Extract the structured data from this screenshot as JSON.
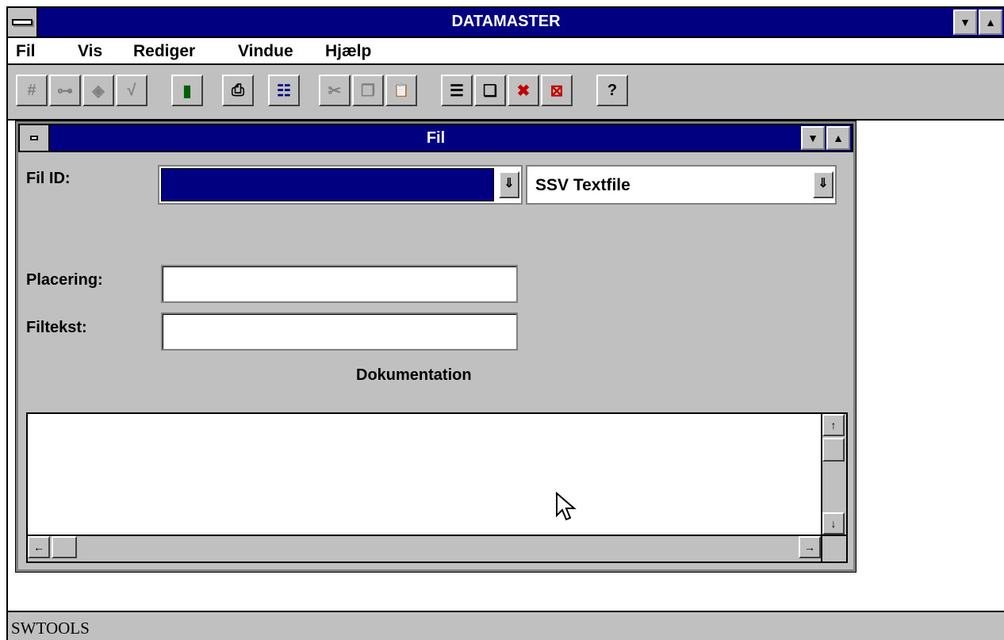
{
  "app": {
    "title": "DATAMASTER",
    "status_text": "SWTOOLS"
  },
  "menu": {
    "items": [
      {
        "label": "Fil"
      },
      {
        "label": "Vis"
      },
      {
        "label": "Rediger"
      },
      {
        "label": "Vindue"
      },
      {
        "label": "Hjælp"
      }
    ]
  },
  "toolbar": {
    "buttons": [
      {
        "glyph": "#",
        "icon": "number-icon",
        "enabled": false
      },
      {
        "glyph": "⊶",
        "icon": "key-icon",
        "enabled": false
      },
      {
        "glyph": "◈",
        "icon": "tag-icon",
        "enabled": false
      },
      {
        "glyph": "√",
        "icon": "check-icon",
        "enabled": false
      },
      {
        "glyph": "▮",
        "icon": "trash-icon",
        "enabled": true
      },
      {
        "glyph": "⎙",
        "icon": "print-icon",
        "enabled": true
      },
      {
        "glyph": "☷",
        "icon": "structure-icon",
        "enabled": true
      },
      {
        "glyph": "✂",
        "icon": "cut-icon",
        "enabled": false
      },
      {
        "glyph": "❐",
        "icon": "copy-icon",
        "enabled": false
      },
      {
        "glyph": "📋",
        "icon": "paste-icon",
        "enabled": false
      },
      {
        "glyph": "☰",
        "icon": "tile-icon",
        "enabled": true
      },
      {
        "glyph": "❏",
        "icon": "cascade-icon",
        "enabled": true
      },
      {
        "glyph": "✖",
        "icon": "close-all-icon",
        "enabled": true
      },
      {
        "glyph": "⊠",
        "icon": "close-window-icon",
        "enabled": true
      },
      {
        "glyph": "?",
        "icon": "help-icon",
        "enabled": true
      }
    ]
  },
  "window": {
    "title": "Fil",
    "fil_id_label": "Fil ID:",
    "fil_id_value": "",
    "type_value": "SSV Textfile",
    "placering_label": "Placering:",
    "placering_value": "",
    "filtekst_label": "Filtekst:",
    "filtekst_value": "",
    "dokumentation_label": "Dokumentation"
  },
  "colors": {
    "titlebar": "#000080",
    "face": "#c0c0c0"
  }
}
